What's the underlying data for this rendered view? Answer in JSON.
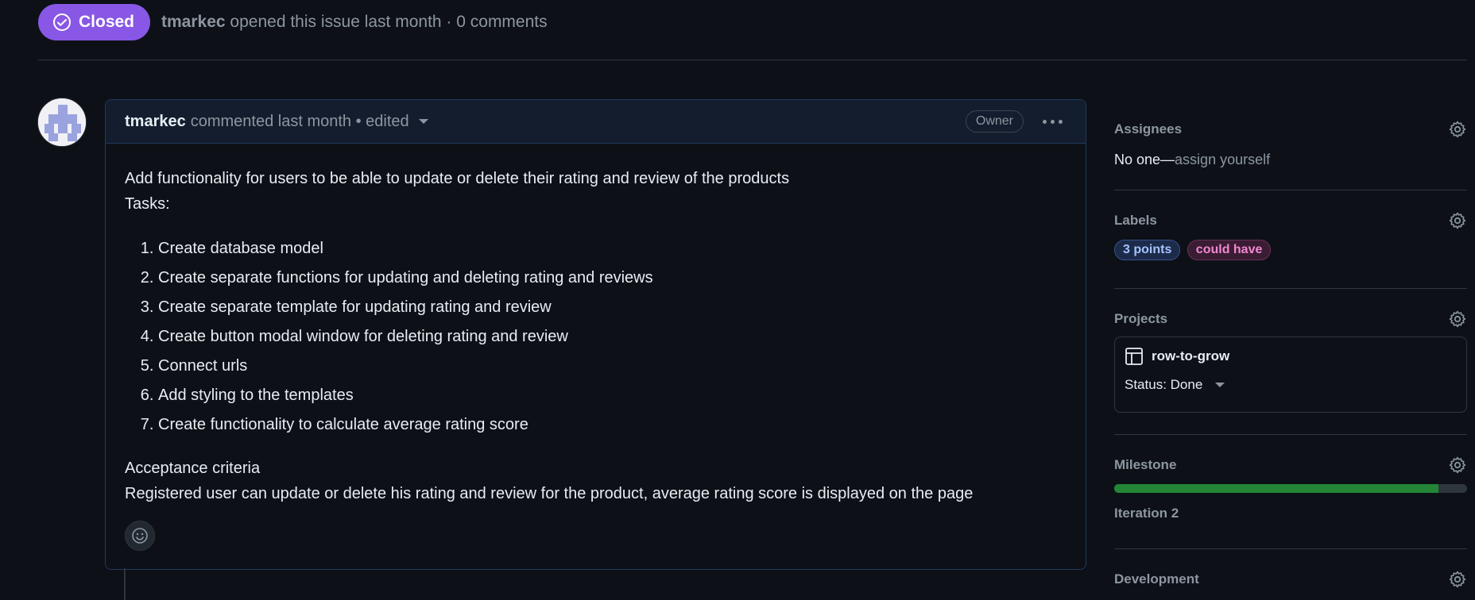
{
  "header": {
    "state_label": "Closed",
    "author": "tmarkec",
    "meta": "opened this issue last month · 0 comments"
  },
  "comment": {
    "author": "tmarkec",
    "meta": "commented last month • edited",
    "owner_badge": "Owner",
    "intro": "Add functionality for users to be able to update or delete their rating and review of the products",
    "tasks_heading": "Tasks:",
    "tasks": [
      "Create database model",
      "Create separate functions for updating and deleting rating and reviews",
      "Create separate template for updating rating and review",
      "Create button modal window for deleting rating and review",
      "Connect urls",
      "Add styling to the templates",
      "Create functionality to calculate average rating score"
    ],
    "acceptance_heading": "Acceptance criteria",
    "acceptance_text": "Registered user can update or delete his rating and review for the product, average rating score is displayed on the page"
  },
  "sidebar": {
    "assignees": {
      "title": "Assignees",
      "value": "No one—",
      "action": "assign yourself"
    },
    "labels": {
      "title": "Labels",
      "items": [
        {
          "name": "3 points",
          "color": "#a5c2ff"
        },
        {
          "name": "could have",
          "color": "#f287d4"
        }
      ]
    },
    "projects": {
      "title": "Projects",
      "name": "row-to-grow",
      "status": "Status: Done"
    },
    "milestone": {
      "title": "Milestone",
      "name": "Iteration 2",
      "progress": 0.92
    },
    "development": {
      "title": "Development"
    }
  },
  "colors": {
    "closed_badge": "#8957e5",
    "progress": "#238636",
    "background": "#0d1117"
  }
}
